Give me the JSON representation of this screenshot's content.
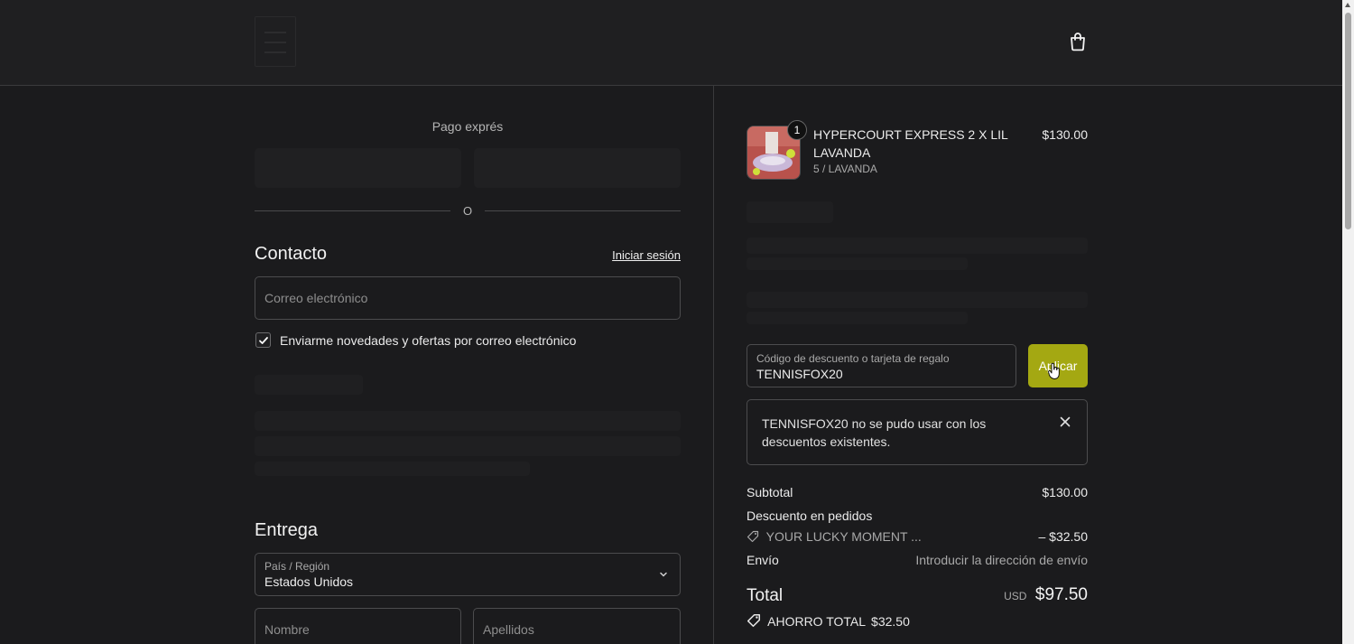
{
  "express": {
    "title": "Pago exprés",
    "or_text": "O"
  },
  "contact": {
    "title": "Contacto",
    "login_link": "Iniciar sesión",
    "email_placeholder": "Correo electrónico",
    "newsletter_label": "Enviarme novedades y ofertas por correo electrónico",
    "newsletter_checked": true
  },
  "delivery": {
    "title": "Entrega",
    "country_label": "País / Región",
    "country_value": "Estados Unidos",
    "first_name_placeholder": "Nombre",
    "last_name_placeholder": "Apellidos"
  },
  "cart": {
    "item": {
      "name": "HYPERCOURT EXPRESS 2 X LIL LAVANDA",
      "variant": "5 / LAVANDA",
      "price": "$130.00",
      "quantity": "1"
    },
    "discount": {
      "label": "Código de descuento o tarjeta de regalo",
      "value": "TENNISFOX20",
      "apply_label": "Aplicar"
    },
    "error": {
      "message": "TENNISFOX20 no se pudo usar con los descuentos existentes."
    },
    "summary": {
      "subtotal_label": "Subtotal",
      "subtotal_value": "$130.00",
      "order_discount_label": "Descuento en pedidos",
      "discount_code": "YOUR LUCKY MOMENT ...",
      "discount_amount": "– $32.50",
      "shipping_label": "Envío",
      "shipping_value": "Introducir la dirección de envío",
      "total_label": "Total",
      "currency": "USD",
      "total_value": "$97.50",
      "savings_label": "AHORRO TOTAL",
      "savings_value": "$32.50"
    }
  },
  "colors": {
    "background": "#1b1b1d",
    "accent_button": "#a4a812",
    "border": "#4c4c4e"
  }
}
